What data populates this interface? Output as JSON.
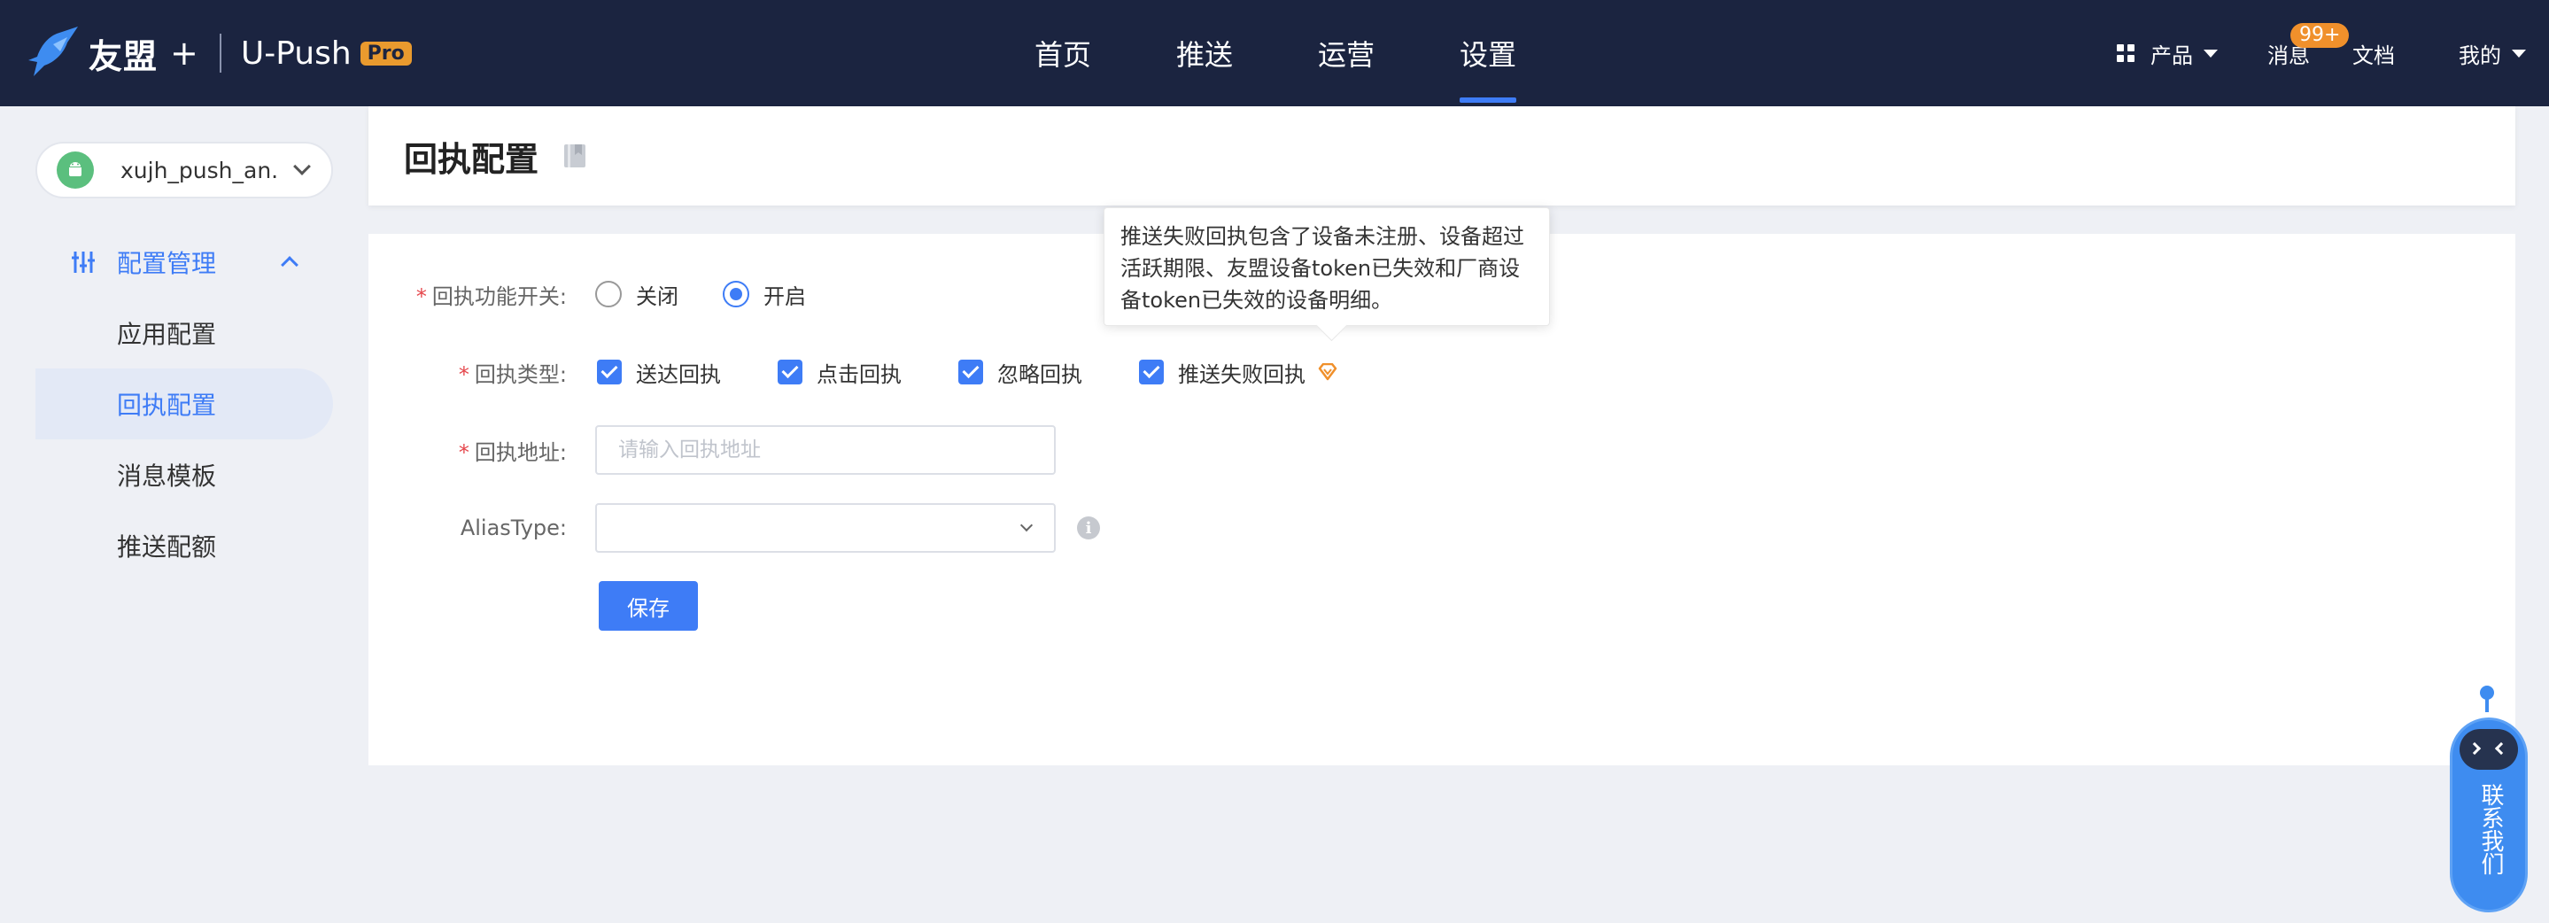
{
  "brand": {
    "name": "友盟",
    "plus": "+",
    "product": "U-Push",
    "badge": "Pro"
  },
  "nav": {
    "items": [
      "首页",
      "推送",
      "运营",
      "设置"
    ],
    "active": "设置"
  },
  "topRight": {
    "product": "产品",
    "messages": "消息",
    "messageCount": "99+",
    "docs": "文档",
    "mine": "我的"
  },
  "sidebar": {
    "app": "xujh_push_an...",
    "group": "配置管理",
    "items": [
      "应用配置",
      "回执配置",
      "消息模板",
      "推送配额"
    ],
    "active": "回执配置"
  },
  "page": {
    "title": "回执配置"
  },
  "form": {
    "switch_label": "回执功能开关:",
    "switch_options": [
      "关闭",
      "开启"
    ],
    "switch_selected": "开启",
    "type_label": "回执类型:",
    "type_options": [
      "送达回执",
      "点击回执",
      "忽略回执",
      "推送失败回执"
    ],
    "address_label": "回执地址:",
    "address_value": "",
    "address_placeholder": "请输入回执地址",
    "alias_label": "AliasType:",
    "alias_value": "",
    "save": "保存"
  },
  "tooltip": "推送失败回执包含了设备未注册、设备超过活跃期限、友盟设备token已失效和厂商设备token已失效的设备明细。",
  "contact": "联系我们",
  "colors": {
    "nav_bg": "#1b2440",
    "accent": "#3e7cf6",
    "badge": "#f0902b",
    "required": "#e5484d"
  }
}
